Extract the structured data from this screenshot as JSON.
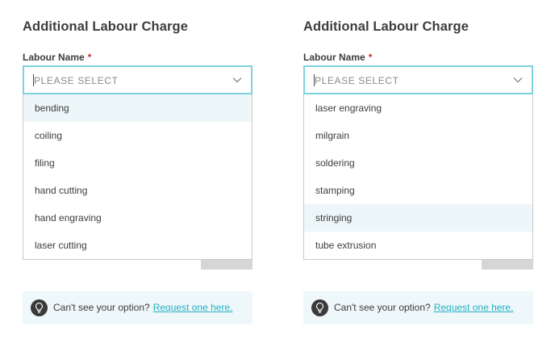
{
  "panels": [
    {
      "title": "Additional Labour Charge",
      "field_label": "Labour Name",
      "required_mark": "*",
      "placeholder": "PLEASE SELECT",
      "options": [
        "bending",
        "coiling",
        "filing",
        "hand cutting",
        "hand engraving",
        "laser cutting"
      ],
      "highlighted_option": "bending",
      "hint_text": "Can't see your option?",
      "hint_link": "Request one here."
    },
    {
      "title": "Additional Labour Charge",
      "field_label": "Labour Name",
      "required_mark": "*",
      "placeholder": "PLEASE SELECT",
      "options": [
        "laser engraving",
        "milgrain",
        "soldering",
        "stamping",
        "stringing",
        "tube extrusion"
      ],
      "highlighted_option": "stringing",
      "hint_text": "Can't see your option?",
      "hint_link": "Request one here."
    }
  ],
  "icons": {
    "chevron": "chevron-down-icon",
    "hint": "lightbulb-icon"
  },
  "colors": {
    "focus_border": "#7fd1dd",
    "link": "#27b0c4",
    "highlight_bg": "#edf6f8",
    "required": "#c0392b"
  }
}
